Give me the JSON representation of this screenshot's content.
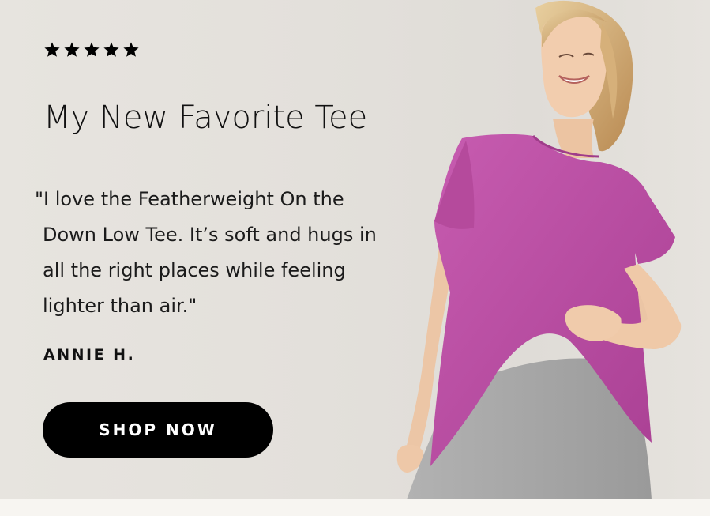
{
  "review": {
    "rating": 5,
    "rating_max": 5,
    "headline": "My New Favorite Tee",
    "quote": "\"I love the Featherweight On the Down Low Tee. It’s soft and hugs in all the right places while feeling lighter than air.\"",
    "author": "ANNIE H."
  },
  "cta": {
    "label": "SHOP NOW"
  },
  "colors": {
    "background": "#e4e1dc",
    "text": "#111111",
    "button_bg": "#000000",
    "button_text": "#ffffff",
    "tee": "#c04fa8",
    "shorts": "#a8a8a8"
  },
  "icons": {
    "rating": "star-icon"
  }
}
